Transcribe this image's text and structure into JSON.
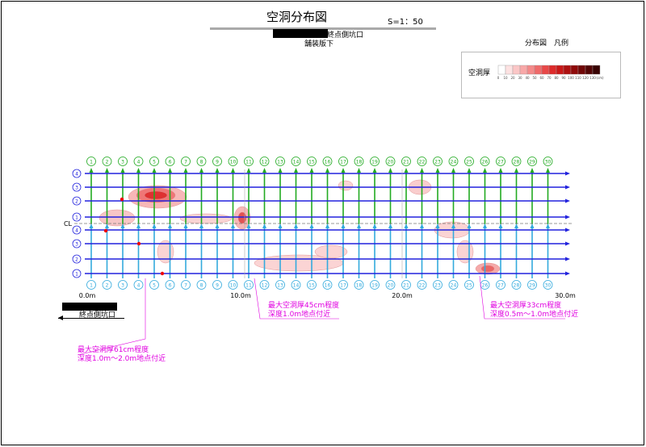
{
  "title": "空洞分布図",
  "scale": "S=1：50",
  "end_label": "終点側坑口",
  "paving": "舗装版下",
  "legend": {
    "title": "分布図　凡例",
    "label": "空洞厚",
    "ticks": [
      "0",
      "10",
      "20",
      "30",
      "40",
      "50",
      "60",
      "70",
      "80",
      "90",
      "100",
      "110",
      "120",
      "130",
      "(cm)"
    ],
    "colors": [
      "#ffffff",
      "#fde2e2",
      "#fbc6c6",
      "#f8a8a8",
      "#f48a8a",
      "#ef6a6a",
      "#e84848",
      "#dd2a2a",
      "#c81818",
      "#ad1010",
      "#8f0a0a",
      "#700606",
      "#520404",
      "#380202"
    ]
  },
  "start_label": "終点側坑口",
  "cl_label": "CL",
  "col_numbers": [
    "1",
    "2",
    "3",
    "4",
    "5",
    "6",
    "7",
    "8",
    "9",
    "10",
    "11",
    "12",
    "13",
    "14",
    "15",
    "16",
    "17",
    "18",
    "19",
    "20",
    "21",
    "22",
    "23",
    "24",
    "25",
    "26",
    "27",
    "28",
    "29",
    "30"
  ],
  "row_numbers_top": [
    "4",
    "3",
    "2",
    "1"
  ],
  "row_numbers_bottom": [
    "4",
    "3",
    "2",
    "1"
  ],
  "distance_labels": [
    "0.0m",
    "10.0m",
    "20.0m",
    "30.0m"
  ],
  "annotations": [
    {
      "line1": "最大空洞厚61cm程度",
      "line2": "深度1.0m～2.0m地点付近"
    },
    {
      "line1": "最大空洞厚45cm程度",
      "line2": "深度1.0m地点付近"
    },
    {
      "line1": "最大空洞厚33cm程度",
      "line2": "深度0.5m～1.0m地点付近"
    }
  ],
  "colors": {
    "grid_blue": "#2222dd",
    "grid_green": "#22aa22",
    "grid_cyan": "#33aadd",
    "annotation": "#e000e0",
    "marker": "#ee0000"
  }
}
